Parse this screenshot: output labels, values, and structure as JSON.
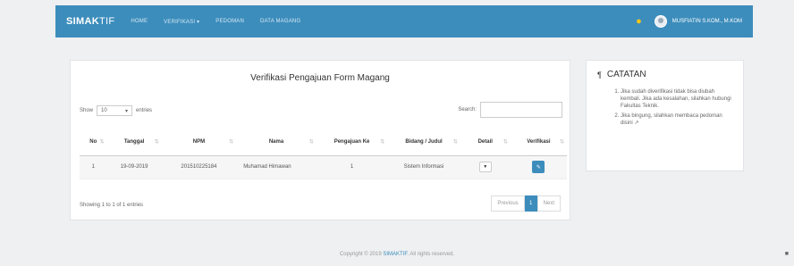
{
  "navbar": {
    "brand": "SIMAK",
    "brand_suffix": "TIF",
    "links": [
      "HOME",
      "VERIFIKASI ▾",
      "PEDOMAN",
      "DATA MAGANG"
    ],
    "user": "MUSFIATIN S.KOM., M.KOM",
    "notification_icon": "bell-icon"
  },
  "card": {
    "title": "Verifikasi Pengajuan Form Magang",
    "show_label": "Show",
    "show_value": "10",
    "entries_label": "entries",
    "search_label": "Search:",
    "search_value": "",
    "columns": [
      "No",
      "Tanggal",
      "NPM",
      "Nama",
      "Pengajuan Ke",
      "Bidang / Judul",
      "Detail",
      "Verifikasi"
    ],
    "rows": [
      {
        "no": "1",
        "tanggal": "19-09-2019",
        "npm": "201510225184",
        "nama": "Muhamad Himawan",
        "pengajuan": "1",
        "bidang": "Sistem Informasi"
      }
    ],
    "showing": "Showing 1 to 1 of 1 entries",
    "pagination": {
      "prev": "Previous",
      "current": "1",
      "next": "Next"
    }
  },
  "notes": {
    "title": "CATATAN",
    "items": [
      "Jika sudah diverifikasi tidak bisa diubah kembali. Jika ada kesalahan, silahkan hubungi Fakultas Teknik.",
      "Jika bingung, silahkan membaca pedoman disini"
    ]
  },
  "footer": {
    "prefix": "Copyright © 2019",
    "brand": "SIMAKTIF",
    "suffix": "All rights reserved."
  },
  "colors": {
    "primary": "#3c8dbc",
    "background": "#eef0f2"
  }
}
